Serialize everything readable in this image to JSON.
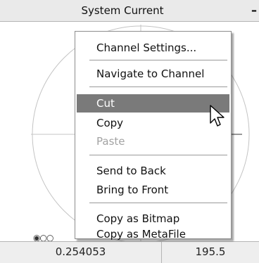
{
  "window": {
    "title": "System Current",
    "minimize_glyph": "–"
  },
  "plot": {
    "indicators": "◉○○"
  },
  "statusbar": {
    "left_value": "0.254053",
    "right_value": "195.5"
  },
  "context_menu": {
    "items": [
      {
        "label": "Channel Settings...",
        "state": "normal"
      },
      {
        "label": "Navigate to Channel",
        "state": "normal"
      },
      {
        "label": "Cut",
        "state": "highlighted"
      },
      {
        "label": "Copy",
        "state": "normal"
      },
      {
        "label": "Paste",
        "state": "disabled"
      },
      {
        "label": "Send to Back",
        "state": "normal"
      },
      {
        "label": "Bring to Front",
        "state": "normal"
      },
      {
        "label": "Copy as Bitmap",
        "state": "normal"
      },
      {
        "label": "Copy as MetaFile",
        "state": "normal"
      }
    ]
  },
  "cursor": {
    "icon": "arrow-pointer-icon"
  },
  "colors": {
    "highlight": "#7a7a7a",
    "titlebar": "#eaeaea",
    "disabled_text": "#a3a3a3"
  }
}
